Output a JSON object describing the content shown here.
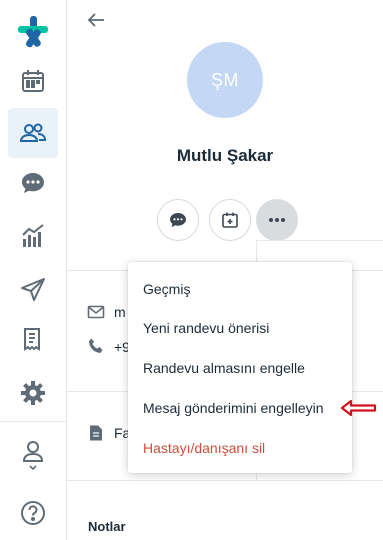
{
  "sidebar": {
    "items": [
      {
        "name": "docplanner-logo",
        "icon": "asterisk-logo-icon"
      },
      {
        "name": "calendar",
        "icon": "calendar-icon"
      },
      {
        "name": "patients",
        "icon": "users-icon",
        "active": true
      },
      {
        "name": "messages",
        "icon": "chat-icon"
      },
      {
        "name": "statistics",
        "icon": "chart-icon"
      },
      {
        "name": "campaigns",
        "icon": "paper-plane-icon"
      },
      {
        "name": "invoices",
        "icon": "receipt-icon"
      },
      {
        "name": "settings",
        "icon": "gear-icon"
      },
      {
        "name": "profile",
        "icon": "doctor-profile-icon"
      },
      {
        "name": "help",
        "icon": "question-icon"
      }
    ]
  },
  "patient": {
    "initials": "ŞM",
    "name": "Mutlu Şakar",
    "email_partial": "m",
    "phone_partial": "+9",
    "files_partial": "Fa"
  },
  "sections": {
    "notes_label": "Notlar"
  },
  "menu": {
    "history": "Geçmiş",
    "new_appointment": "Yeni randevu önerisi",
    "block_booking": "Randevu almasını engelle",
    "block_messages": "Mesaj gönderimini engelleyin",
    "delete_patient": "Hastayı/danışanı sil"
  },
  "colors": {
    "primary": "#1f66a6",
    "accent": "#00c3a5",
    "avatar_bg": "#c4d7f5",
    "danger": "#d14d3a",
    "arrow": "#d3101b",
    "active_bg": "#e9f1f9"
  }
}
